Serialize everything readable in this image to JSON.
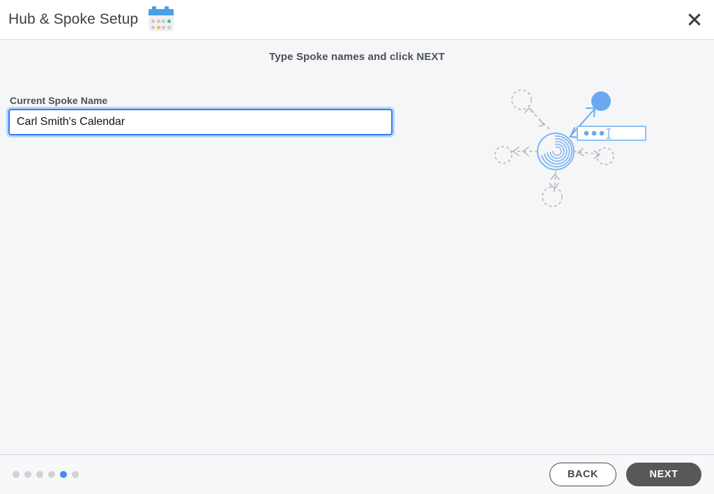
{
  "window": {
    "title": "Hub & Spoke Setup",
    "title_icon": "calendar-icon",
    "close_icon": "close-icon",
    "background_color": "#f5f6f8",
    "header_background": "#ffffff"
  },
  "calendar_icon": {
    "header_color": "#4a9fe8",
    "body_color": "#f0f0f0",
    "dots": [
      {
        "color": "#c9c9c9",
        "state": "inactive"
      },
      {
        "color": "#c9c9c9",
        "state": "inactive"
      },
      {
        "color": "#c9c9c9",
        "state": "inactive"
      },
      {
        "color": "#3fc099",
        "state": "green"
      },
      {
        "color": "#c9c9c9",
        "state": "inactive"
      },
      {
        "color": "#f2c14a",
        "state": "yellow"
      },
      {
        "color": "#c9c9c9",
        "state": "inactive"
      },
      {
        "color": "#c9c9c9",
        "state": "inactive"
      }
    ]
  },
  "main": {
    "instruction": "Type Spoke names and click NEXT",
    "field": {
      "label": "Current Spoke Name",
      "value": "Carl Smith's Calendar",
      "placeholder": "",
      "focused": true,
      "focus_color": "#2f7cf6"
    }
  },
  "illustration": {
    "name": "hub-and-spoke-diagram",
    "hub_color": "#7cb6f2",
    "spoke_color": "#b7b9bc",
    "active_node_color": "#6aa9f0",
    "textbox_border_color": "#8cc0f5",
    "textbox_dots": 3,
    "spoke_count": 5,
    "active_spoke_index": 1
  },
  "footer": {
    "pagination": {
      "total": 6,
      "active_index": 4,
      "active_color": "#3d8ef0",
      "inactive_color": "#d0d2d5"
    },
    "back_label": "BACK",
    "next_label": "NEXT",
    "next_background": "#58585a"
  }
}
